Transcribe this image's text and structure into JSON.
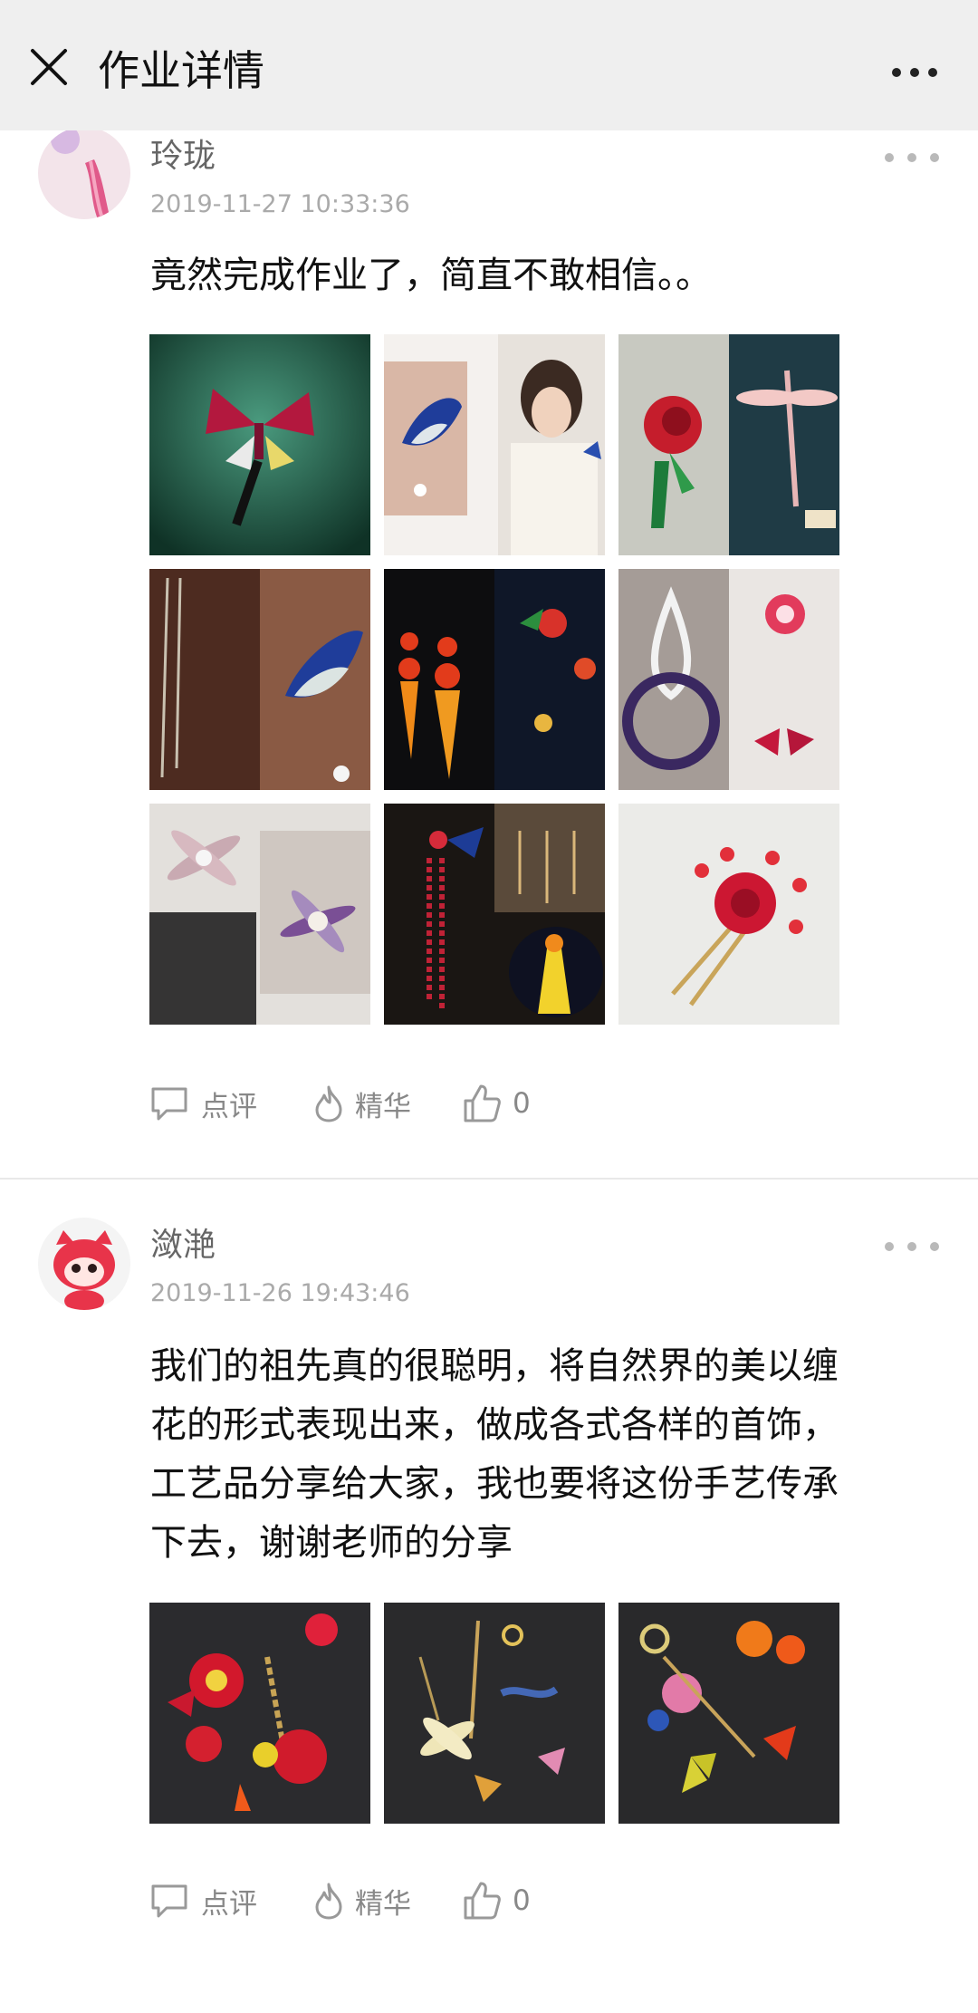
{
  "topbar": {
    "title": "作业详情",
    "close_icon": "close-icon",
    "more_icon": "more-horizontal-icon"
  },
  "posts": [
    {
      "username": "玲珑",
      "timestamp": "2019-11-27 10:33:36",
      "text": "竟然完成作业了，简直不敢相信。。",
      "avatar": "avatar-pink-tassel",
      "actions": {
        "comment": "点评",
        "featured": "精华",
        "like_count": "0"
      }
    },
    {
      "username": "潋滟",
      "timestamp": "2019-11-26 19:43:46",
      "text_lines": [
        "我们的祖先真的很聪明，将自然界的美以缠",
        "花的形式表现出来，做成各式各样的首饰，",
        "工艺品分享给大家，我也要将这份手艺传承",
        "下去，谢谢老师的分享"
      ],
      "avatar": "avatar-red-cat",
      "actions": {
        "comment": "点评",
        "featured": "精华",
        "like_count": "0"
      }
    }
  ],
  "colors": {
    "topbar_bg": "#efefef",
    "muted_text": "#888888",
    "timestamp": "#aaaaaa",
    "divider": "#e9e9e9"
  }
}
